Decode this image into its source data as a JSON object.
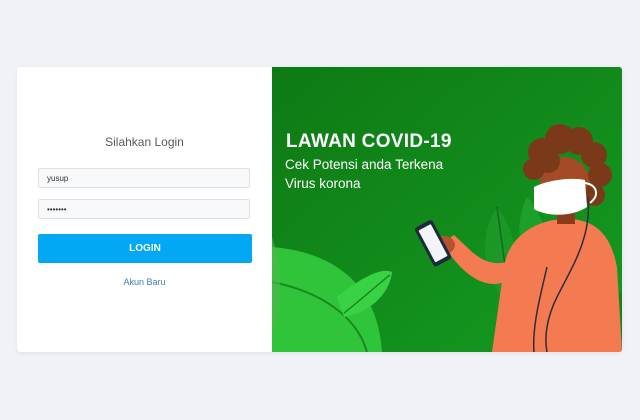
{
  "login": {
    "title": "Silahkan Login",
    "username_value": "yusup",
    "password_value": "yusupid",
    "button_label": "LOGIN",
    "new_account_link": "Akun Baru"
  },
  "banner": {
    "headline": "LAWAN COVID-19",
    "subtitle_line1": "Cek Potensi anda Terkena",
    "subtitle_line2": "Virus korona"
  },
  "colors": {
    "page_background": "#eff2f6",
    "primary_button": "#02a8f4",
    "link": "#3b7bbf",
    "banner_green": "#128a1c",
    "person_orange": "#f47a52"
  }
}
